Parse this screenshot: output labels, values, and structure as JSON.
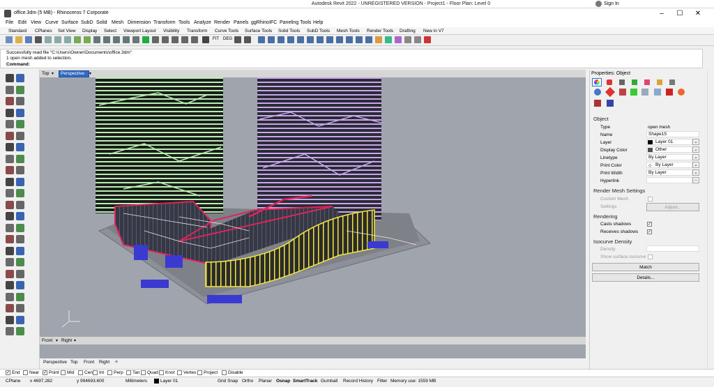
{
  "revit": {
    "title": "Autodesk Revit 2022 - UNREGISTERED VERSION - Project1 - Floor Plan: Level 0",
    "signin": "Sign In"
  },
  "window": {
    "title": "office.3dm (5 MB) - Rhinoceros 7 Corporate"
  },
  "menu": [
    "File",
    "Edit",
    "View",
    "Curve",
    "Surface",
    "SubD",
    "Solid",
    "Mesh",
    "Dimension",
    "Transform",
    "Tools",
    "Analyze",
    "Render",
    "Panels",
    "ggRhinoIFC",
    "Paneling Tools",
    "Help"
  ],
  "tabs": [
    "Standard",
    "CPlanes",
    "Set View",
    "Display",
    "Select",
    "Viewport Layout",
    "Visibility",
    "Transform",
    "Curve Tools",
    "Surface Tools",
    "Solid Tools",
    "SubD Tools",
    "Mesh Tools",
    "Render Tools",
    "Drafting",
    "New in V7"
  ],
  "toolbar_labels": [
    "FIT",
    "DEG"
  ],
  "command": {
    "line1": "Successfully read file \"C:\\Users\\Owner\\Documents\\office.3dm\"",
    "line2": "1 open mesh added to selection.",
    "prompt": "Command:"
  },
  "viewports": {
    "top": "Top",
    "perspective": "Perspective",
    "front": "Front",
    "right": "Right"
  },
  "viewport_tabs": [
    "Perspective",
    "Top",
    "Front",
    "Right"
  ],
  "properties": {
    "header": "Properties: Object",
    "object_section": "Object",
    "rows": [
      {
        "label": "Type",
        "value": "open mesh"
      },
      {
        "label": "Name",
        "value": "Shape15"
      },
      {
        "label": "Layer",
        "value": "Layer 01"
      },
      {
        "label": "Display Color",
        "value": "Other"
      },
      {
        "label": "Linetype",
        "value": "By Layer"
      },
      {
        "label": "Print Color",
        "value": "By Layer"
      },
      {
        "label": "Print Width",
        "value": "By Layer"
      },
      {
        "label": "Hyperlink",
        "value": ""
      }
    ],
    "render_mesh_section": "Render Mesh Settings",
    "custom_mesh": "Custom Mesh",
    "settings": "Settings",
    "adjust": "Adjust...",
    "rendering_section": "Rendering",
    "casts_shadows": "Casts shadows",
    "receives_shadows": "Receives shadows",
    "isocurve_section": "Isocurve Density",
    "density": "Density",
    "show_iso": "Show surface isocurve",
    "match": "Match",
    "details": "Details..."
  },
  "osnaps": [
    {
      "label": "End",
      "checked": true
    },
    {
      "label": "Near",
      "checked": false
    },
    {
      "label": "Point",
      "checked": true
    },
    {
      "label": "Mid",
      "checked": false
    },
    {
      "label": "Cen",
      "checked": false
    },
    {
      "label": "Int",
      "checked": false
    },
    {
      "label": "Perp",
      "checked": false
    },
    {
      "label": "Tan",
      "checked": false
    },
    {
      "label": "Quad",
      "checked": false
    },
    {
      "label": "Knot",
      "checked": false
    },
    {
      "label": "Vertex",
      "checked": false
    },
    {
      "label": "Project",
      "checked": false
    },
    {
      "label": "Disable",
      "checked": false
    }
  ],
  "status": {
    "cplane": "CPlane",
    "x": "x 4697.282",
    "y": "y 994693.600",
    "units": "Millimeters",
    "layer": "Layer 01",
    "items": [
      "Grid Snap",
      "Ortho",
      "Planar",
      "Osnap",
      "SmartTrack",
      "Gumball",
      "Record History",
      "Filter"
    ],
    "memory": "Memory use: 1559 MB"
  },
  "colors": {
    "accent": "#316ac5",
    "facade_green": "#b7f0b0",
    "facade_purple": "#c8a6f0",
    "red_band": "#e0245a",
    "yellow_sel": "#f2e642",
    "blue_patch": "#3a3ad0"
  }
}
